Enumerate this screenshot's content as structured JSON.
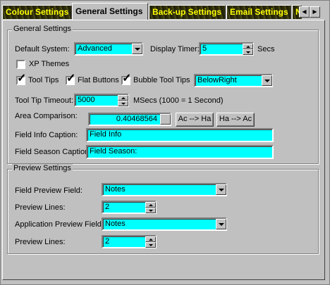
{
  "tabs": [
    {
      "label": "Colour Settings",
      "active": false
    },
    {
      "label": "General Settings",
      "active": true
    },
    {
      "label": "Back-up Settings",
      "active": false
    },
    {
      "label": "Email Settings",
      "active": false
    },
    {
      "label": "N",
      "active": false
    }
  ],
  "general": {
    "group_label": "General Settings",
    "default_system_label": "Default System:",
    "default_system_value": "Advanced",
    "display_timer_label": "Display Timer:",
    "display_timer_value": "5",
    "display_timer_unit": "Secs",
    "xp_themes_label": "XP Themes",
    "xp_themes_checked": false,
    "tool_tips_label": "Tool Tips",
    "flat_buttons_label": "Flat Buttons",
    "bubble_tool_tips_label": "Bubble Tool Tips",
    "bubble_position_value": "BelowRight",
    "tool_tip_timeout_label": "Tool Tip Timeout:",
    "tool_tip_timeout_value": "5000",
    "tool_tip_timeout_unit": "MSecs (1000 = 1 Second)",
    "area_comparison_label": "Area Comparison:",
    "area_comparison_value": "0.40468564",
    "ac_to_ha_label": "Ac --> Ha",
    "ha_to_ac_label": "Ha --> Ac",
    "field_info_caption_label": "Field Info Caption:",
    "field_info_caption_value": "Field Info",
    "field_season_caption_label": "Field Season Caption:",
    "field_season_caption_value": "Field Season:"
  },
  "preview": {
    "group_label": "Preview Settings",
    "field_preview_field_label": "Field Preview Field:",
    "field_preview_field_value": "Notes",
    "preview_lines_label_1": "Preview Lines:",
    "preview_lines_value_1": "2",
    "application_preview_field_label": "Application Preview Field:",
    "application_preview_field_value": "Notes",
    "preview_lines_label_2": "Preview Lines:",
    "preview_lines_value_2": "2"
  }
}
